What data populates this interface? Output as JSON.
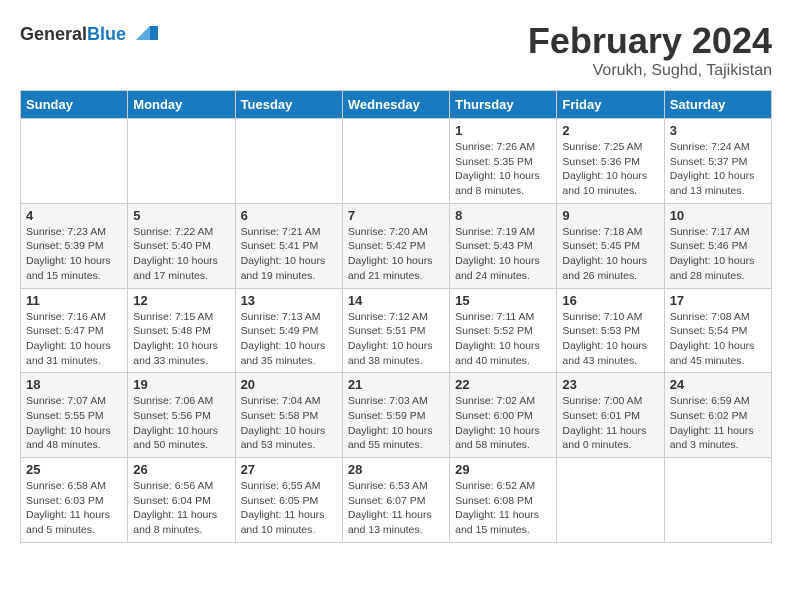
{
  "header": {
    "logo_general": "General",
    "logo_blue": "Blue",
    "title": "February 2024",
    "subtitle": "Vorukh, Sughd, Tajikistan"
  },
  "weekdays": [
    "Sunday",
    "Monday",
    "Tuesday",
    "Wednesday",
    "Thursday",
    "Friday",
    "Saturday"
  ],
  "weeks": [
    [
      {
        "day": "",
        "info": ""
      },
      {
        "day": "",
        "info": ""
      },
      {
        "day": "",
        "info": ""
      },
      {
        "day": "",
        "info": ""
      },
      {
        "day": "1",
        "info": "Sunrise: 7:26 AM\nSunset: 5:35 PM\nDaylight: 10 hours\nand 8 minutes."
      },
      {
        "day": "2",
        "info": "Sunrise: 7:25 AM\nSunset: 5:36 PM\nDaylight: 10 hours\nand 10 minutes."
      },
      {
        "day": "3",
        "info": "Sunrise: 7:24 AM\nSunset: 5:37 PM\nDaylight: 10 hours\nand 13 minutes."
      }
    ],
    [
      {
        "day": "4",
        "info": "Sunrise: 7:23 AM\nSunset: 5:39 PM\nDaylight: 10 hours\nand 15 minutes."
      },
      {
        "day": "5",
        "info": "Sunrise: 7:22 AM\nSunset: 5:40 PM\nDaylight: 10 hours\nand 17 minutes."
      },
      {
        "day": "6",
        "info": "Sunrise: 7:21 AM\nSunset: 5:41 PM\nDaylight: 10 hours\nand 19 minutes."
      },
      {
        "day": "7",
        "info": "Sunrise: 7:20 AM\nSunset: 5:42 PM\nDaylight: 10 hours\nand 21 minutes."
      },
      {
        "day": "8",
        "info": "Sunrise: 7:19 AM\nSunset: 5:43 PM\nDaylight: 10 hours\nand 24 minutes."
      },
      {
        "day": "9",
        "info": "Sunrise: 7:18 AM\nSunset: 5:45 PM\nDaylight: 10 hours\nand 26 minutes."
      },
      {
        "day": "10",
        "info": "Sunrise: 7:17 AM\nSunset: 5:46 PM\nDaylight: 10 hours\nand 28 minutes."
      }
    ],
    [
      {
        "day": "11",
        "info": "Sunrise: 7:16 AM\nSunset: 5:47 PM\nDaylight: 10 hours\nand 31 minutes."
      },
      {
        "day": "12",
        "info": "Sunrise: 7:15 AM\nSunset: 5:48 PM\nDaylight: 10 hours\nand 33 minutes."
      },
      {
        "day": "13",
        "info": "Sunrise: 7:13 AM\nSunset: 5:49 PM\nDaylight: 10 hours\nand 35 minutes."
      },
      {
        "day": "14",
        "info": "Sunrise: 7:12 AM\nSunset: 5:51 PM\nDaylight: 10 hours\nand 38 minutes."
      },
      {
        "day": "15",
        "info": "Sunrise: 7:11 AM\nSunset: 5:52 PM\nDaylight: 10 hours\nand 40 minutes."
      },
      {
        "day": "16",
        "info": "Sunrise: 7:10 AM\nSunset: 5:53 PM\nDaylight: 10 hours\nand 43 minutes."
      },
      {
        "day": "17",
        "info": "Sunrise: 7:08 AM\nSunset: 5:54 PM\nDaylight: 10 hours\nand 45 minutes."
      }
    ],
    [
      {
        "day": "18",
        "info": "Sunrise: 7:07 AM\nSunset: 5:55 PM\nDaylight: 10 hours\nand 48 minutes."
      },
      {
        "day": "19",
        "info": "Sunrise: 7:06 AM\nSunset: 5:56 PM\nDaylight: 10 hours\nand 50 minutes."
      },
      {
        "day": "20",
        "info": "Sunrise: 7:04 AM\nSunset: 5:58 PM\nDaylight: 10 hours\nand 53 minutes."
      },
      {
        "day": "21",
        "info": "Sunrise: 7:03 AM\nSunset: 5:59 PM\nDaylight: 10 hours\nand 55 minutes."
      },
      {
        "day": "22",
        "info": "Sunrise: 7:02 AM\nSunset: 6:00 PM\nDaylight: 10 hours\nand 58 minutes."
      },
      {
        "day": "23",
        "info": "Sunrise: 7:00 AM\nSunset: 6:01 PM\nDaylight: 11 hours\nand 0 minutes."
      },
      {
        "day": "24",
        "info": "Sunrise: 6:59 AM\nSunset: 6:02 PM\nDaylight: 11 hours\nand 3 minutes."
      }
    ],
    [
      {
        "day": "25",
        "info": "Sunrise: 6:58 AM\nSunset: 6:03 PM\nDaylight: 11 hours\nand 5 minutes."
      },
      {
        "day": "26",
        "info": "Sunrise: 6:56 AM\nSunset: 6:04 PM\nDaylight: 11 hours\nand 8 minutes."
      },
      {
        "day": "27",
        "info": "Sunrise: 6:55 AM\nSunset: 6:05 PM\nDaylight: 11 hours\nand 10 minutes."
      },
      {
        "day": "28",
        "info": "Sunrise: 6:53 AM\nSunset: 6:07 PM\nDaylight: 11 hours\nand 13 minutes."
      },
      {
        "day": "29",
        "info": "Sunrise: 6:52 AM\nSunset: 6:08 PM\nDaylight: 11 hours\nand 15 minutes."
      },
      {
        "day": "",
        "info": ""
      },
      {
        "day": "",
        "info": ""
      }
    ]
  ]
}
